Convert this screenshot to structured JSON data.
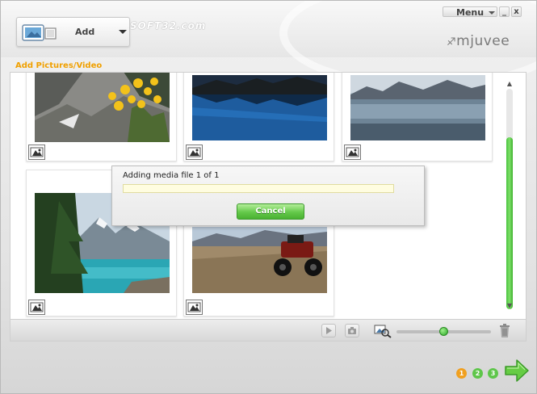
{
  "header": {
    "add_button_label": "Add",
    "watermark": "SOFT32.com",
    "menu_label": "Menu",
    "minimize_glyph": "_",
    "close_glyph": "x",
    "logo": "mjuvee"
  },
  "section_title": "Add Pictures/Video",
  "gallery": {
    "items": [
      {
        "subject": "yellow flowers on rocky mountain slope"
      },
      {
        "subject": "dark mountain lake with reflection"
      },
      {
        "subject": "lake with distant mountains"
      },
      {
        "subject": "turquoise mountain lake with pine trees"
      },
      {
        "subject": "ATV on desert beach"
      }
    ],
    "item_icon": "photo-edit-icon"
  },
  "dialog": {
    "message": "Adding media file 1 of 1",
    "progress": 0,
    "cancel_label": "Cancel"
  },
  "toolbar": {
    "play_icon": "play-icon",
    "camera_icon": "camera-icon",
    "zoom_icon": "zoom-icon",
    "trash_icon": "trash-icon",
    "zoom_level": 0.5
  },
  "steps": [
    "1",
    "2",
    "3"
  ],
  "colors": {
    "accent_orange": "#f0a000",
    "accent_green": "#49b131",
    "step1": "#f0a020",
    "step_other": "#5ec64a"
  }
}
